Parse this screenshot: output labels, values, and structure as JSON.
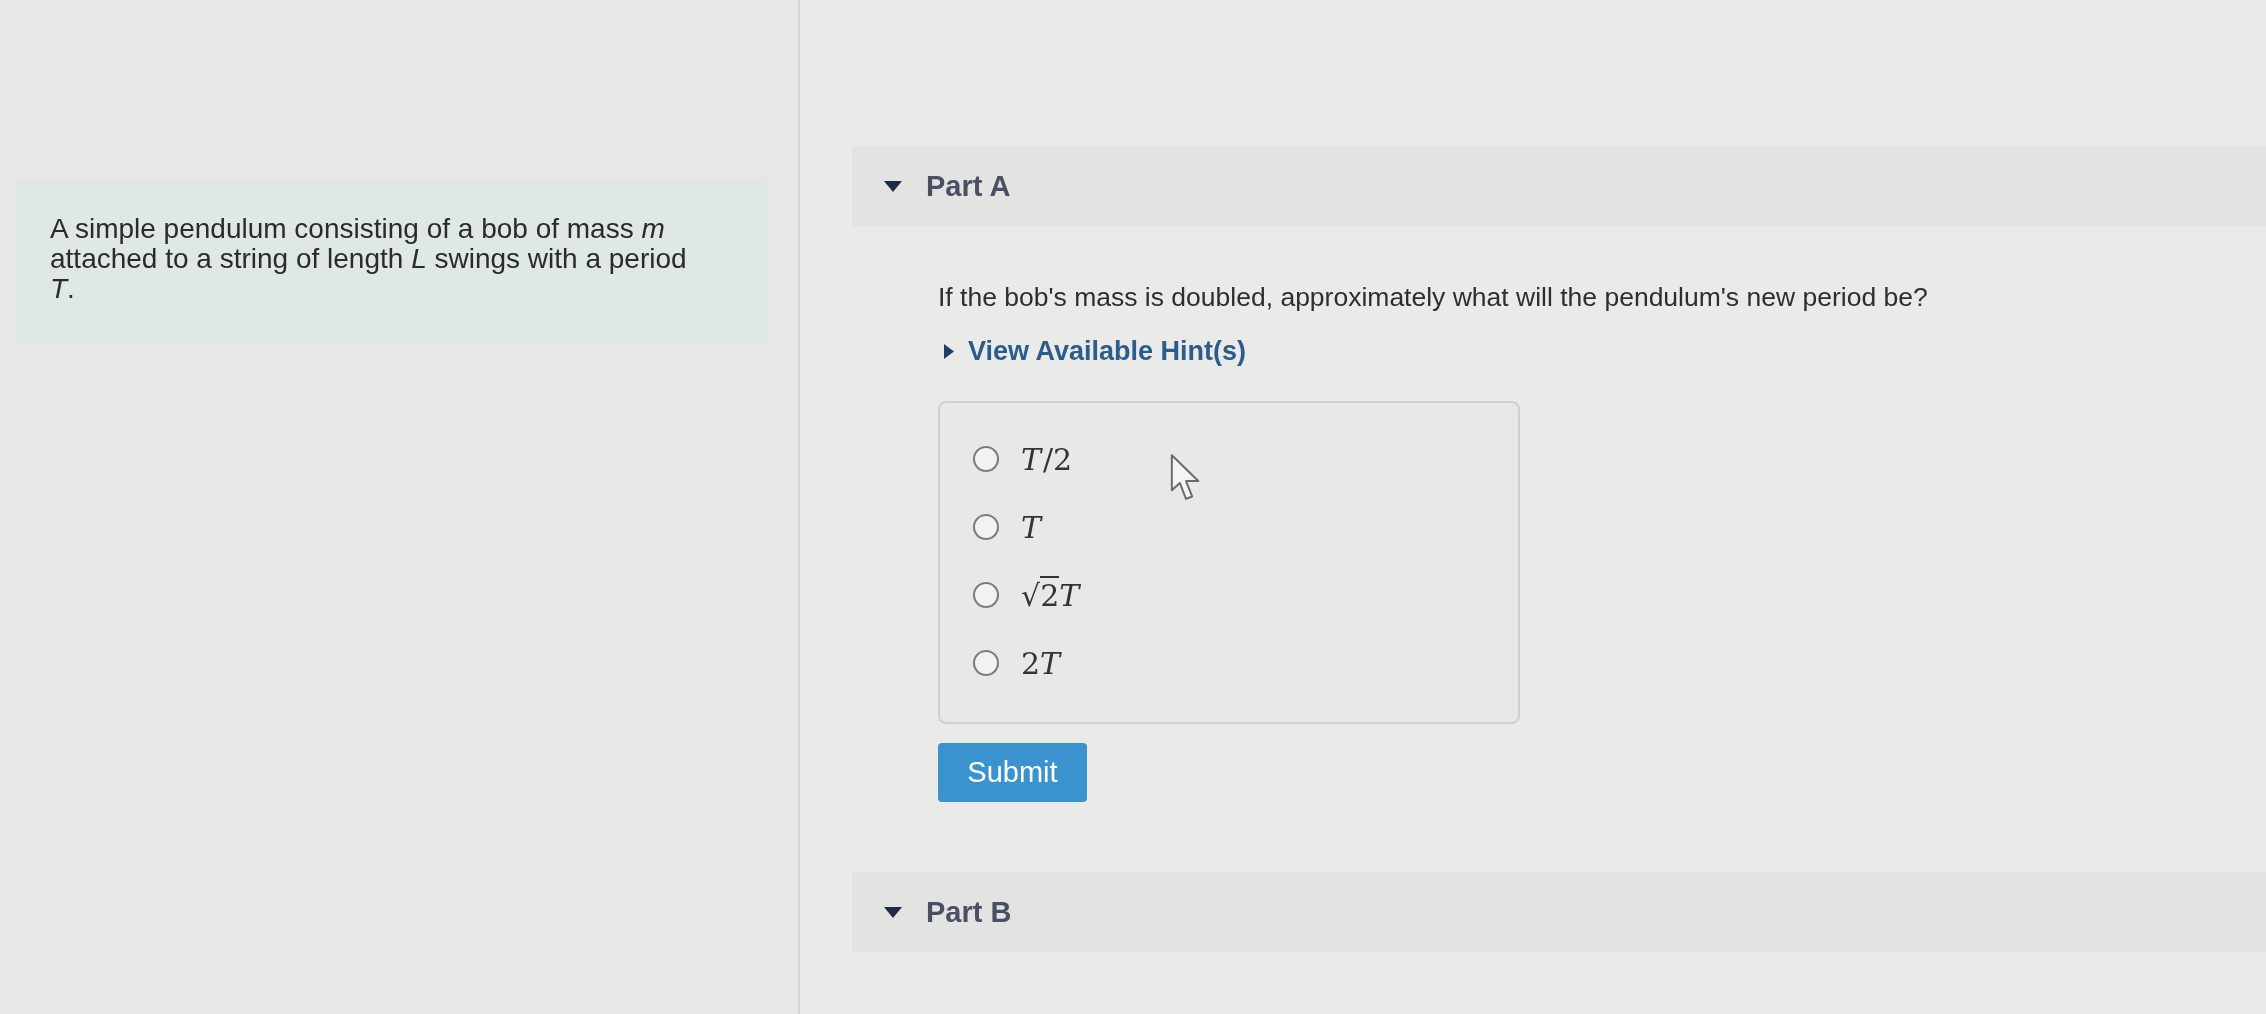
{
  "problem": {
    "text": "A simple pendulum consisting of a bob of mass *m* attached to a string of length *L* swings with a period *T*."
  },
  "parts": [
    {
      "label": "Part A",
      "expanded": true,
      "question": "If the bob's mass is doubled, approximately what will the pendulum's new period be?",
      "hint": {
        "label": "View Available Hint(s)",
        "expanded": false
      },
      "choices": [
        {
          "segments": [
            {
              "kind": "variable",
              "text": "T"
            },
            {
              "kind": "number",
              "text": "/2"
            }
          ],
          "selected": false
        },
        {
          "segments": [
            {
              "kind": "variable",
              "text": "T"
            }
          ],
          "selected": false
        },
        {
          "segments": [
            {
              "kind": "radical",
              "text": "√"
            },
            {
              "kind": "radicand",
              "text": "2"
            },
            {
              "kind": "variable",
              "text": "T"
            }
          ],
          "selected": false
        },
        {
          "segments": [
            {
              "kind": "number",
              "text": "2"
            },
            {
              "kind": "variable",
              "text": "T"
            }
          ],
          "selected": false
        }
      ],
      "submit": "Submit"
    },
    {
      "label": "Part B",
      "expanded": true
    }
  ]
}
